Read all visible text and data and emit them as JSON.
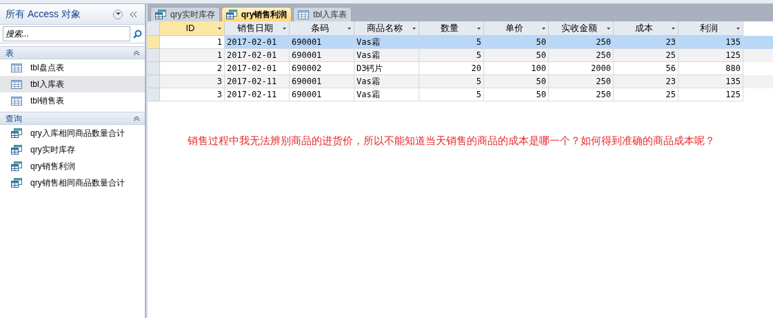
{
  "nav_pane": {
    "title": "所有 Access 对象",
    "search": {
      "placeholder": "搜索..."
    },
    "groups": [
      {
        "label": "表",
        "expanded": true,
        "items": [
          {
            "kind": "table",
            "label": "tbl盘点表",
            "selected": false
          },
          {
            "kind": "table",
            "label": "tbl入库表",
            "selected": true
          },
          {
            "kind": "table",
            "label": "tbl销售表",
            "selected": false
          }
        ]
      },
      {
        "label": "查询",
        "expanded": true,
        "items": [
          {
            "kind": "query",
            "label": "qry入库相同商品数量合计",
            "selected": false
          },
          {
            "kind": "query",
            "label": "qry实时库存",
            "selected": false
          },
          {
            "kind": "query",
            "label": "qry销售利润",
            "selected": false
          },
          {
            "kind": "query",
            "label": "qry销售相同商品数量合计",
            "selected": false
          }
        ]
      }
    ]
  },
  "tabs": [
    {
      "kind": "query",
      "label": "qry实时库存",
      "selected": false
    },
    {
      "kind": "query",
      "label": "qry销售利润",
      "selected": true
    },
    {
      "kind": "table",
      "label": "tbl入库表",
      "selected": false
    }
  ],
  "table": {
    "columns": [
      "ID",
      "销售日期",
      "条码",
      "商品名称",
      "数量",
      "单价",
      "实收金额",
      "成本",
      "利润"
    ],
    "rows": [
      {
        "selected": true,
        "cells": [
          "1",
          "2017-02-01",
          "690001",
          "Vas霜",
          "5",
          "50",
          "250",
          "23",
          "135"
        ]
      },
      {
        "selected": false,
        "cells": [
          "1",
          "2017-02-01",
          "690001",
          "Vas霜",
          "5",
          "50",
          "250",
          "25",
          "125"
        ]
      },
      {
        "selected": false,
        "cells": [
          "2",
          "2017-02-01",
          "690002",
          "D3钙片",
          "20",
          "100",
          "2000",
          "56",
          "880"
        ]
      },
      {
        "selected": false,
        "cells": [
          "3",
          "2017-02-11",
          "690001",
          "Vas霜",
          "5",
          "50",
          "250",
          "23",
          "135"
        ]
      },
      {
        "selected": false,
        "cells": [
          "3",
          "2017-02-11",
          "690001",
          "Vas霜",
          "5",
          "50",
          "250",
          "25",
          "125"
        ]
      }
    ]
  },
  "annotation": "销售过程中我无法辨别商品的进货价，所以不能知道当天销售的商品的成本是哪一个？如何得到准确的商品成本呢？"
}
